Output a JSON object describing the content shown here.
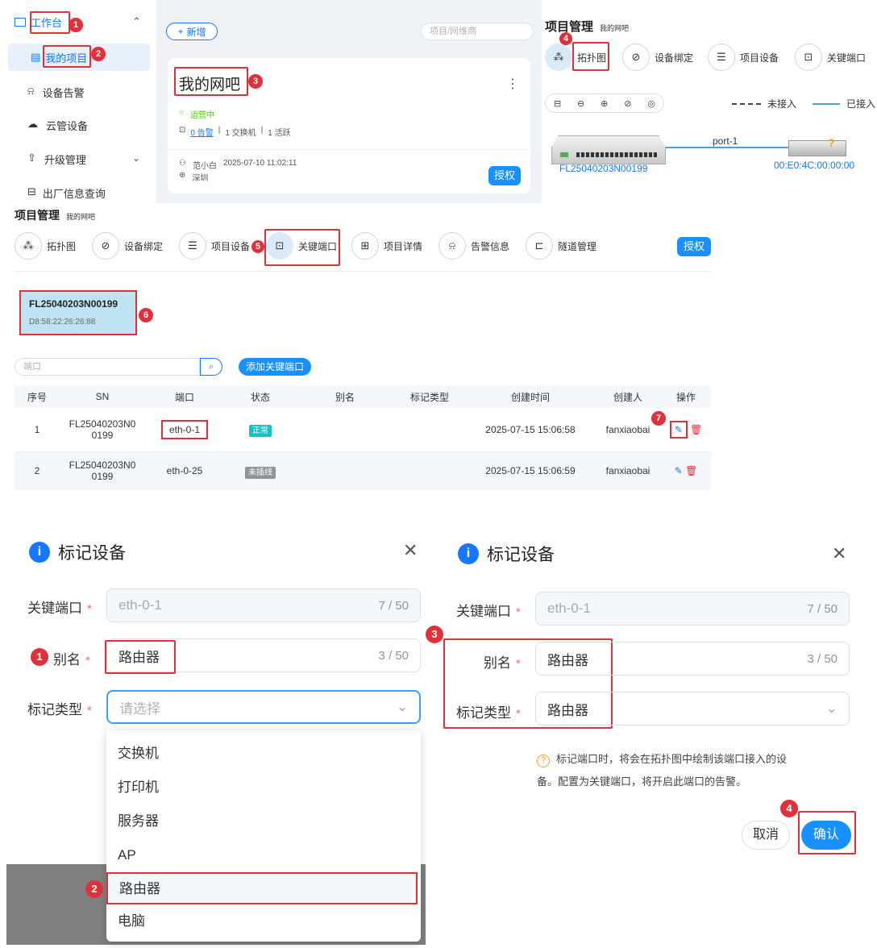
{
  "sidebar": {
    "workbench": "工作台",
    "items": [
      {
        "label": "我的项目",
        "icon": "project-icon"
      },
      {
        "label": "设备告警",
        "icon": "alarm-icon"
      },
      {
        "label": "云管设备",
        "icon": "cloud-icon"
      },
      {
        "label": "升级管理",
        "icon": "upgrade-icon"
      },
      {
        "label": "出厂信息查询",
        "icon": "factory-icon"
      }
    ]
  },
  "projects": {
    "add_label": "新增",
    "search_placeholder": "项目/网维商",
    "card": {
      "title": "我的网吧",
      "status": "运营中",
      "alarms": "0 告警",
      "switches": "1 交换机",
      "active": "1 活跃",
      "owner": "范小白",
      "time": "2025-07-10 11:02:11",
      "city": "深圳",
      "auth_button": "授权"
    }
  },
  "topo_panel": {
    "title": "项目管理",
    "subtitle": "我的网吧",
    "tabs": [
      "拓扑图",
      "设备绑定",
      "项目设备",
      "关键端口"
    ],
    "legend_disconnected": "未接入",
    "legend_connected": "已接入",
    "port_label": "port-1",
    "switch_sn": "FL25040203N00199",
    "device_mac": "00:E0:4C:00:00:00"
  },
  "manage": {
    "title": "项目管理",
    "subtitle": "我的网吧",
    "tabs": [
      "拓扑图",
      "设备绑定",
      "项目设备",
      "关键端口",
      "项目详情",
      "告警信息",
      "隧道管理"
    ],
    "auth_button": "授权",
    "device": {
      "sn": "FL25040203N00199",
      "mac": "D8:58:22:26:26:88"
    },
    "port_placeholder": "端口",
    "add_port_button": "添加关键端口",
    "table": {
      "headers": [
        "序号",
        "SN",
        "端口",
        "状态",
        "别名",
        "标记类型",
        "创建时间",
        "创建人",
        "操作"
      ],
      "rows": [
        {
          "no": "1",
          "sn1": "FL25040203N0",
          "sn2": "0199",
          "port": "eth-0-1",
          "status": "正常",
          "alias": "",
          "type": "",
          "time": "2025-07-15 15:06:58",
          "creator": "fanxiaobai"
        },
        {
          "no": "2",
          "sn1": "FL25040203N0",
          "sn2": "0199",
          "port": "eth-0-25",
          "status": "未插线",
          "alias": "",
          "type": "",
          "time": "2025-07-15 15:06:59",
          "creator": "fanxiaobai"
        }
      ]
    }
  },
  "dialog_left": {
    "title": "标记设备",
    "key_port_label": "关键端口",
    "key_port_value": "eth-0-1",
    "key_port_count": "7 / 50",
    "alias_label": "别名",
    "alias_value": "路由器",
    "alias_count": "3 / 50",
    "type_label": "标记类型",
    "type_placeholder": "请选择",
    "options": [
      "交换机",
      "打印机",
      "服务器",
      "AP",
      "路由器",
      "电脑"
    ]
  },
  "dialog_right": {
    "title": "标记设备",
    "key_port_label": "关键端口",
    "key_port_value": "eth-0-1",
    "key_port_count": "7 / 50",
    "alias_label": "别名",
    "alias_value": "路由器",
    "alias_count": "3 / 50",
    "type_label": "标记类型",
    "type_value": "路由器",
    "tip_line1": "标记端口时，将会在拓扑图中绘制该端口接入的设",
    "tip_line2": "备。配置为关键端口，将开启此端口的告警。",
    "cancel": "取消",
    "confirm": "确认"
  },
  "markers": [
    "1",
    "2",
    "3",
    "4",
    "5",
    "6",
    "7",
    "1",
    "2",
    "3",
    "4"
  ],
  "colors": {
    "accent": "#1890ff",
    "annotation": "#e0313a",
    "ok": "#13c2c2"
  }
}
